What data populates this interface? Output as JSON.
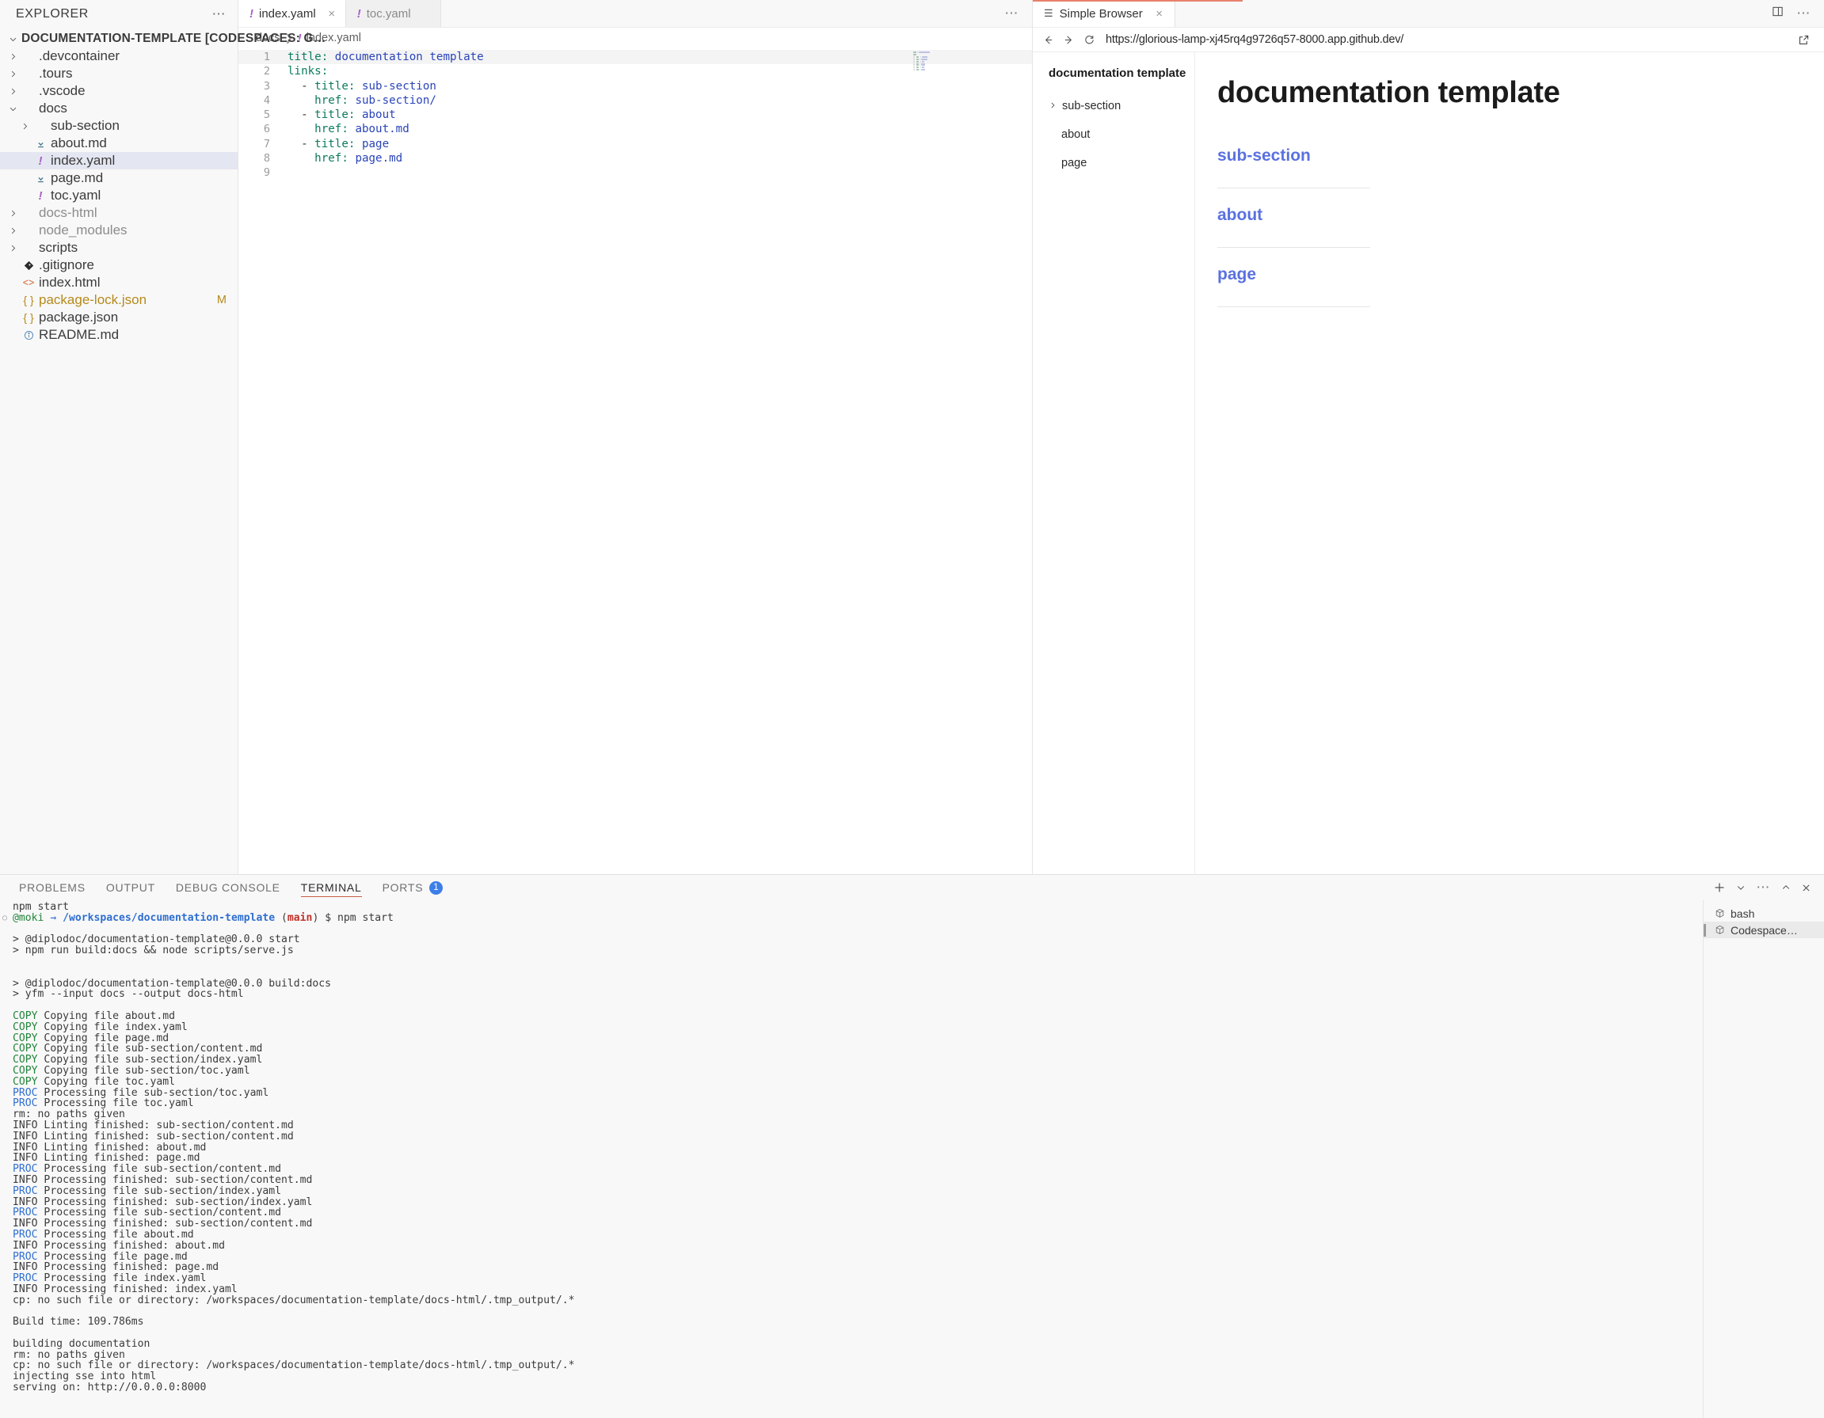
{
  "explorer": {
    "title": "EXPLORER",
    "more_label": "…",
    "root": "DOCUMENTATION-TEMPLATE [CODESPACES: G…",
    "items": [
      {
        "label": ".devcontainer",
        "type": "folder",
        "depth": 1,
        "expanded": false
      },
      {
        "label": ".tours",
        "type": "folder",
        "depth": 1,
        "expanded": false
      },
      {
        "label": ".vscode",
        "type": "folder",
        "depth": 1,
        "expanded": false
      },
      {
        "label": "docs",
        "type": "folder",
        "depth": 1,
        "expanded": true
      },
      {
        "label": "sub-section",
        "type": "folder",
        "depth": 2,
        "expanded": false
      },
      {
        "label": "about.md",
        "type": "md",
        "depth": 2
      },
      {
        "label": "index.yaml",
        "type": "yaml",
        "depth": 2,
        "selected": true
      },
      {
        "label": "page.md",
        "type": "md",
        "depth": 2
      },
      {
        "label": "toc.yaml",
        "type": "yaml",
        "depth": 2
      },
      {
        "label": "docs-html",
        "type": "folder",
        "depth": 1,
        "expanded": false,
        "dim": true
      },
      {
        "label": "node_modules",
        "type": "folder",
        "depth": 1,
        "expanded": false,
        "dim": true
      },
      {
        "label": "scripts",
        "type": "folder",
        "depth": 1,
        "expanded": false
      },
      {
        "label": ".gitignore",
        "type": "git",
        "depth": 1
      },
      {
        "label": "index.html",
        "type": "html",
        "depth": 1
      },
      {
        "label": "package-lock.json",
        "type": "json",
        "depth": 1,
        "badge": "M",
        "modified": true
      },
      {
        "label": "package.json",
        "type": "json",
        "depth": 1
      },
      {
        "label": "README.md",
        "type": "info",
        "depth": 1
      }
    ]
  },
  "editor": {
    "tabs": [
      {
        "label": "index.yaml",
        "icon": "yaml-icon",
        "active": true,
        "close": "×"
      },
      {
        "label": "toc.yaml",
        "icon": "yaml-icon",
        "active": false
      }
    ],
    "more_label": "…",
    "breadcrumb": [
      "docs",
      "index.yaml"
    ],
    "lines": [
      {
        "n": "1",
        "current": true,
        "tokens": [
          {
            "t": "title:",
            "c": "key"
          },
          {
            "t": " ",
            "c": "plain"
          },
          {
            "t": "documentation template",
            "c": "val"
          }
        ]
      },
      {
        "n": "2",
        "tokens": [
          {
            "t": "links:",
            "c": "key"
          }
        ]
      },
      {
        "n": "3",
        "tokens": [
          {
            "t": "  - ",
            "c": "plain"
          },
          {
            "t": "title:",
            "c": "key"
          },
          {
            "t": " ",
            "c": "plain"
          },
          {
            "t": "sub-section",
            "c": "val"
          }
        ]
      },
      {
        "n": "4",
        "tokens": [
          {
            "t": "    ",
            "c": "plain"
          },
          {
            "t": "href:",
            "c": "key"
          },
          {
            "t": " ",
            "c": "plain"
          },
          {
            "t": "sub-section/",
            "c": "val"
          }
        ]
      },
      {
        "n": "5",
        "tokens": [
          {
            "t": "  - ",
            "c": "plain"
          },
          {
            "t": "title:",
            "c": "key"
          },
          {
            "t": " ",
            "c": "plain"
          },
          {
            "t": "about",
            "c": "val"
          }
        ]
      },
      {
        "n": "6",
        "tokens": [
          {
            "t": "    ",
            "c": "plain"
          },
          {
            "t": "href:",
            "c": "key"
          },
          {
            "t": " ",
            "c": "plain"
          },
          {
            "t": "about.md",
            "c": "val"
          }
        ]
      },
      {
        "n": "7",
        "tokens": [
          {
            "t": "  - ",
            "c": "plain"
          },
          {
            "t": "title:",
            "c": "key"
          },
          {
            "t": " ",
            "c": "plain"
          },
          {
            "t": "page",
            "c": "val"
          }
        ]
      },
      {
        "n": "8",
        "tokens": [
          {
            "t": "    ",
            "c": "plain"
          },
          {
            "t": "href:",
            "c": "key"
          },
          {
            "t": " ",
            "c": "plain"
          },
          {
            "t": "page.md",
            "c": "val"
          }
        ]
      },
      {
        "n": "9",
        "tokens": []
      }
    ]
  },
  "browser": {
    "tab_label": "Simple Browser",
    "tab_close": "×",
    "url": "https://glorious-lamp-xj45rq4g9726q57-8000.app.github.dev/",
    "nav": {
      "back": "back-icon",
      "forward": "forward-icon",
      "reload": "reload-icon",
      "open_external": "open-external-icon"
    },
    "page": {
      "toc_title": "documentation template",
      "toc_items": [
        {
          "label": "sub-section",
          "expandable": true
        },
        {
          "label": "about",
          "expandable": false
        },
        {
          "label": "page",
          "expandable": false
        }
      ],
      "heading": "documentation template",
      "links": [
        "sub-section",
        "about",
        "page"
      ]
    }
  },
  "panel": {
    "tabs": [
      {
        "label": "PROBLEMS",
        "active": false
      },
      {
        "label": "OUTPUT",
        "active": false
      },
      {
        "label": "DEBUG CONSOLE",
        "active": false
      },
      {
        "label": "TERMINAL",
        "active": true
      },
      {
        "label": "PORTS",
        "active": false,
        "badge": "1"
      }
    ],
    "actions": [
      "new-terminal-icon",
      "chevron-down-icon",
      "more-icon",
      "chevron-up-icon",
      "close-icon"
    ],
    "terminal_list": [
      {
        "label": "bash",
        "active": false
      },
      {
        "label": "Codespace…",
        "active": true
      }
    ],
    "terminal_lines": [
      {
        "segs": [
          {
            "t": "npm start",
            "c": "gray"
          }
        ]
      },
      {
        "dot": true,
        "segs": [
          {
            "t": "@moki",
            "c": "green"
          },
          {
            "t": " ",
            "c": "gray"
          },
          {
            "t": "→",
            "c": "blue"
          },
          {
            "t": " ",
            "c": "gray"
          },
          {
            "t": "/workspaces/documentation-template",
            "c": "blueb"
          },
          {
            "t": " (",
            "c": "gray"
          },
          {
            "t": "main",
            "c": "red"
          },
          {
            "t": ") $ npm start",
            "c": "gray"
          }
        ]
      },
      {
        "segs": []
      },
      {
        "segs": [
          {
            "t": "> @diplodoc/documentation-template@0.0.0 start",
            "c": "gray"
          }
        ]
      },
      {
        "segs": [
          {
            "t": "> npm run build:docs && node scripts/serve.js",
            "c": "gray"
          }
        ]
      },
      {
        "segs": []
      },
      {
        "segs": []
      },
      {
        "segs": [
          {
            "t": "> @diplodoc/documentation-template@0.0.0 build:docs",
            "c": "gray"
          }
        ]
      },
      {
        "segs": [
          {
            "t": "> yfm --input docs --output docs-html",
            "c": "gray"
          }
        ]
      },
      {
        "segs": []
      },
      {
        "segs": [
          {
            "t": "COPY",
            "c": "green"
          },
          {
            "t": " Copying file about.md",
            "c": "gray"
          }
        ]
      },
      {
        "segs": [
          {
            "t": "COPY",
            "c": "green"
          },
          {
            "t": " Copying file index.yaml",
            "c": "gray"
          }
        ]
      },
      {
        "segs": [
          {
            "t": "COPY",
            "c": "green"
          },
          {
            "t": " Copying file page.md",
            "c": "gray"
          }
        ]
      },
      {
        "segs": [
          {
            "t": "COPY",
            "c": "green"
          },
          {
            "t": " Copying file sub-section/content.md",
            "c": "gray"
          }
        ]
      },
      {
        "segs": [
          {
            "t": "COPY",
            "c": "green"
          },
          {
            "t": " Copying file sub-section/index.yaml",
            "c": "gray"
          }
        ]
      },
      {
        "segs": [
          {
            "t": "COPY",
            "c": "green"
          },
          {
            "t": " Copying file sub-section/toc.yaml",
            "c": "gray"
          }
        ]
      },
      {
        "segs": [
          {
            "t": "COPY",
            "c": "green"
          },
          {
            "t": " Copying file toc.yaml",
            "c": "gray"
          }
        ]
      },
      {
        "segs": [
          {
            "t": "PROC",
            "c": "blue"
          },
          {
            "t": " Processing file sub-section/toc.yaml",
            "c": "gray"
          }
        ]
      },
      {
        "segs": [
          {
            "t": "PROC",
            "c": "blue"
          },
          {
            "t": " Processing file toc.yaml",
            "c": "gray"
          }
        ]
      },
      {
        "segs": [
          {
            "t": "rm: no paths given",
            "c": "gray"
          }
        ]
      },
      {
        "segs": [
          {
            "t": "INFO",
            "c": "gray"
          },
          {
            "t": " Linting finished: sub-section/content.md",
            "c": "gray"
          }
        ]
      },
      {
        "segs": [
          {
            "t": "INFO",
            "c": "gray"
          },
          {
            "t": " Linting finished: sub-section/content.md",
            "c": "gray"
          }
        ]
      },
      {
        "segs": [
          {
            "t": "INFO",
            "c": "gray"
          },
          {
            "t": " Linting finished: about.md",
            "c": "gray"
          }
        ]
      },
      {
        "segs": [
          {
            "t": "INFO",
            "c": "gray"
          },
          {
            "t": " Linting finished: page.md",
            "c": "gray"
          }
        ]
      },
      {
        "segs": [
          {
            "t": "PROC",
            "c": "blue"
          },
          {
            "t": " Processing file sub-section/content.md",
            "c": "gray"
          }
        ]
      },
      {
        "segs": [
          {
            "t": "INFO",
            "c": "gray"
          },
          {
            "t": " Processing finished: sub-section/content.md",
            "c": "gray"
          }
        ]
      },
      {
        "segs": [
          {
            "t": "PROC",
            "c": "blue"
          },
          {
            "t": " Processing file sub-section/index.yaml",
            "c": "gray"
          }
        ]
      },
      {
        "segs": [
          {
            "t": "INFO",
            "c": "gray"
          },
          {
            "t": " Processing finished: sub-section/index.yaml",
            "c": "gray"
          }
        ]
      },
      {
        "segs": [
          {
            "t": "PROC",
            "c": "blue"
          },
          {
            "t": " Processing file sub-section/content.md",
            "c": "gray"
          }
        ]
      },
      {
        "segs": [
          {
            "t": "INFO",
            "c": "gray"
          },
          {
            "t": " Processing finished: sub-section/content.md",
            "c": "gray"
          }
        ]
      },
      {
        "segs": [
          {
            "t": "PROC",
            "c": "blue"
          },
          {
            "t": " Processing file about.md",
            "c": "gray"
          }
        ]
      },
      {
        "segs": [
          {
            "t": "INFO",
            "c": "gray"
          },
          {
            "t": " Processing finished: about.md",
            "c": "gray"
          }
        ]
      },
      {
        "segs": [
          {
            "t": "PROC",
            "c": "blue"
          },
          {
            "t": " Processing file page.md",
            "c": "gray"
          }
        ]
      },
      {
        "segs": [
          {
            "t": "INFO",
            "c": "gray"
          },
          {
            "t": " Processing finished: page.md",
            "c": "gray"
          }
        ]
      },
      {
        "segs": [
          {
            "t": "PROC",
            "c": "blue"
          },
          {
            "t": " Processing file index.yaml",
            "c": "gray"
          }
        ]
      },
      {
        "segs": [
          {
            "t": "INFO",
            "c": "gray"
          },
          {
            "t": " Processing finished: index.yaml",
            "c": "gray"
          }
        ]
      },
      {
        "segs": [
          {
            "t": "cp: no such file or directory: /workspaces/documentation-template/docs-html/.tmp_output/.*",
            "c": "gray"
          }
        ]
      },
      {
        "segs": []
      },
      {
        "segs": [
          {
            "t": "Build time: 109.786ms",
            "c": "gray"
          }
        ]
      },
      {
        "segs": []
      },
      {
        "segs": [
          {
            "t": "building documentation",
            "c": "gray"
          }
        ]
      },
      {
        "segs": [
          {
            "t": "rm: no paths given",
            "c": "gray"
          }
        ]
      },
      {
        "segs": [
          {
            "t": "cp: no such file or directory: /workspaces/documentation-template/docs-html/.tmp_output/.*",
            "c": "gray"
          }
        ]
      },
      {
        "segs": [
          {
            "t": "injecting sse into html",
            "c": "gray"
          }
        ]
      },
      {
        "segs": [
          {
            "t": "serving on: http://0.0.0.0:8000",
            "c": "gray"
          }
        ]
      }
    ]
  },
  "colors": {
    "accent_tab_underline": "#c75d45",
    "badge_blue": "#3d7ee8",
    "link_blue": "#5a71e0",
    "yaml_icon": "#a861c4",
    "md_icon": "#42788f",
    "selection": "#e4e6f1"
  }
}
